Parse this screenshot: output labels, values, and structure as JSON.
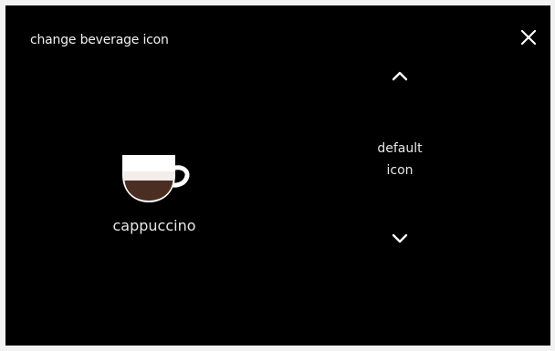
{
  "header": {
    "title": "change beverage icon",
    "close_icon": "close-icon"
  },
  "beverage": {
    "name": "cappuccino",
    "icon": "cappuccino-cup-icon"
  },
  "selector": {
    "up_icon": "chevron-up-icon",
    "option_line1": "default",
    "option_line2": "icon",
    "down_icon": "chevron-down-icon"
  },
  "colors": {
    "background": "#000000",
    "text": "#ffffff",
    "cup": "#ffffff",
    "coffee": "#4a2e23"
  }
}
